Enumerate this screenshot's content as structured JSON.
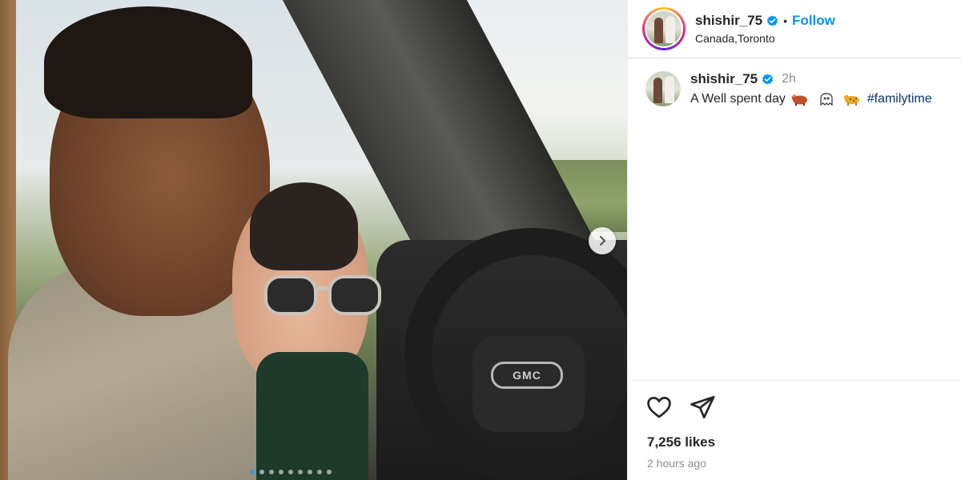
{
  "post": {
    "username": "shishir_75",
    "follow_label": "Follow",
    "separator": "•",
    "location": "Canada,Toronto",
    "caption_user": "shishir_75",
    "caption_time": "2h",
    "caption_text": "A Well spent day",
    "hashtag": "#familytime",
    "likes": "7,256 likes",
    "posted_ago": "2 hours ago",
    "carousel": {
      "slide_count": 9,
      "active_slide": 1
    },
    "vehicle_badge": "GMC"
  },
  "colors": {
    "accent": "#0095f6",
    "hashtag": "#00376b",
    "muted": "#8e8e8e",
    "verified": "#0095f6"
  },
  "icons": {
    "next": "chevron-right-icon",
    "verified": "verified-badge-icon",
    "like": "heart-icon",
    "share": "paper-plane-icon"
  }
}
